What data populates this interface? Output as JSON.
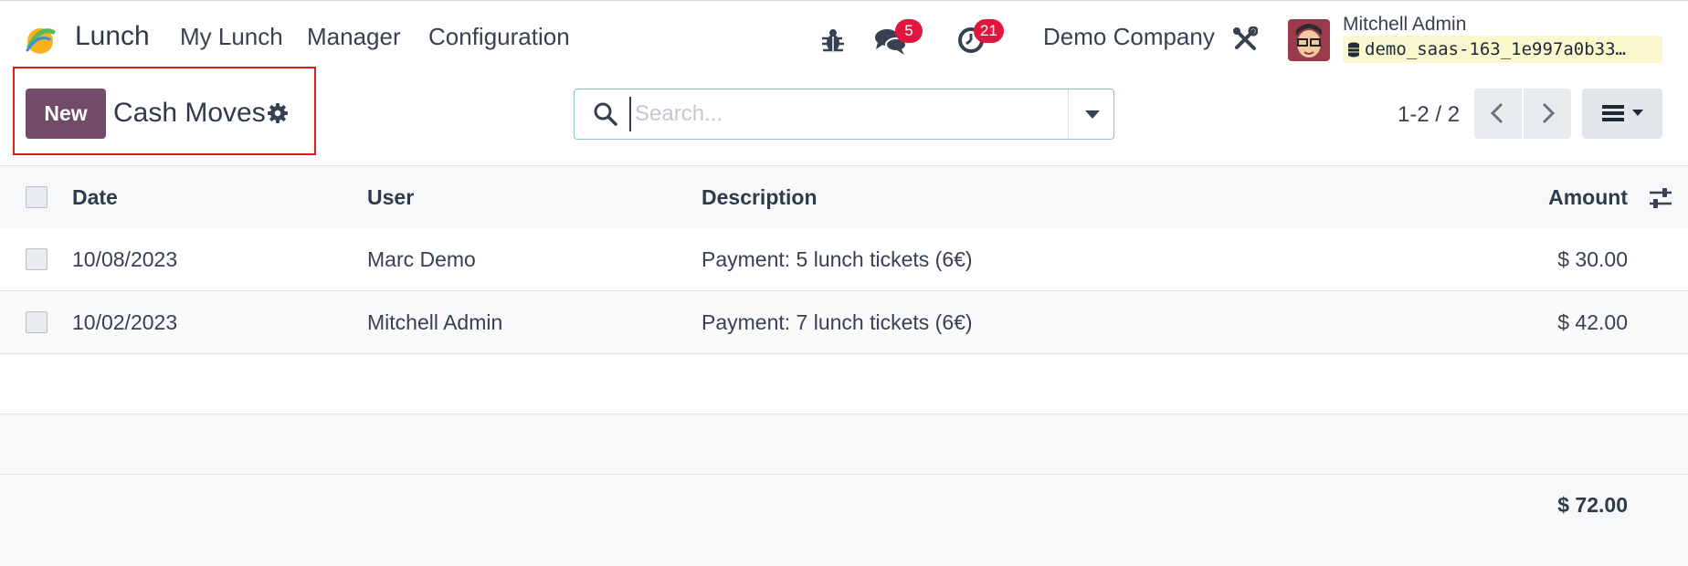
{
  "navbar": {
    "app_name": "Lunch",
    "menus": [
      "My Lunch",
      "Manager",
      "Configuration"
    ],
    "icons": {
      "debug": "bug-icon",
      "messages": "chat-bubbles-icon",
      "activities": "clock-icon",
      "settings": "tools-icon",
      "database": "database-icon"
    },
    "messages_count": "5",
    "activities_count": "21",
    "company": "Demo Company",
    "user_name": "Mitchell Admin",
    "database": "demo_saas-163_1e997a0b33…"
  },
  "control_panel": {
    "new_label": "New",
    "title": "Cash Moves",
    "search_placeholder": "Search...",
    "pager": "1-2 / 2"
  },
  "table": {
    "columns": [
      "Date",
      "User",
      "Description",
      "Amount"
    ],
    "rows": [
      {
        "date": "10/08/2023",
        "user": "Marc Demo",
        "description": "Payment: 5 lunch tickets (6€)",
        "amount": "$ 30.00"
      },
      {
        "date": "10/02/2023",
        "user": "Mitchell Admin",
        "description": "Payment: 7 lunch tickets (6€)",
        "amount": "$ 42.00"
      }
    ],
    "total": "$ 72.00"
  },
  "colors": {
    "brand": "#714b67",
    "badge": "#e1163f",
    "highlight": "#e01b1b"
  }
}
